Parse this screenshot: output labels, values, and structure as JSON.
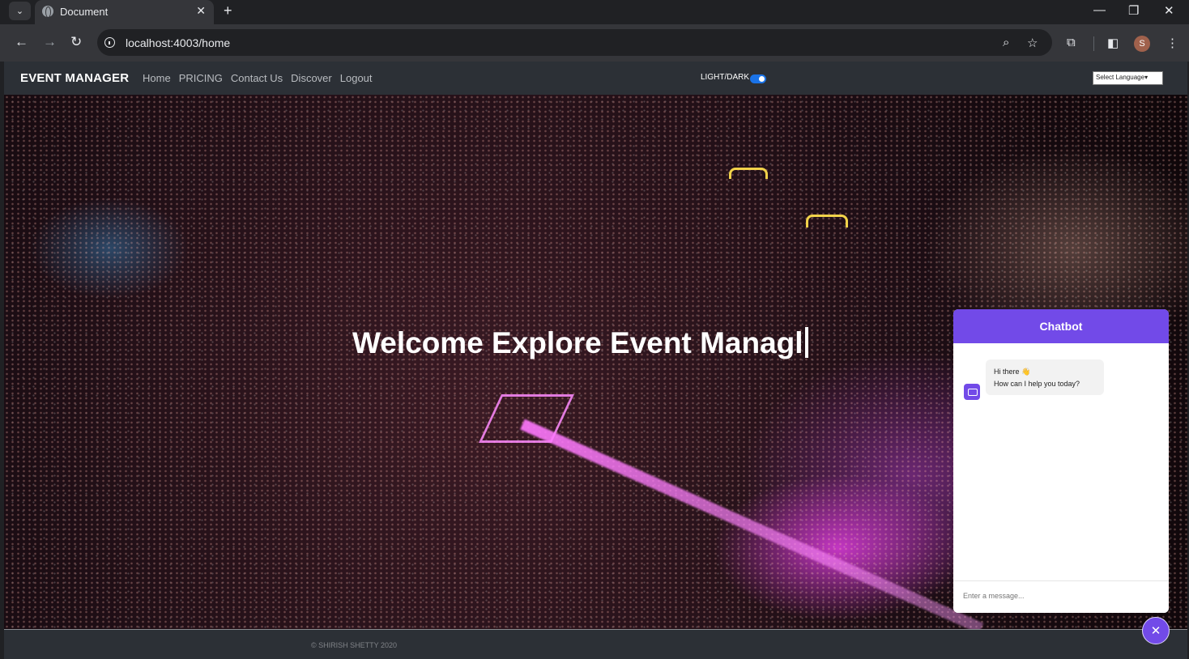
{
  "browser": {
    "tab_title": "Document",
    "url": "localhost:4003/home",
    "profile_initial": "S",
    "icons": {
      "tab_menu": "chevron-down-icon",
      "tab_favicon": "globe-icon",
      "tab_close": "close-icon",
      "new_tab": "plus-icon",
      "back": "arrow-left-icon",
      "forward": "arrow-right-icon",
      "reload": "reload-icon",
      "site_info": "info-icon",
      "zoom": "zoom-icon",
      "bookmark": "star-icon",
      "extensions": "puzzle-icon",
      "side_panel": "side-panel-icon",
      "menu": "kebab-menu-icon"
    }
  },
  "navbar": {
    "brand": "EVENT MANAGER",
    "links": [
      "Home",
      "PRICING",
      "Contact Us",
      "Discover",
      "Logout"
    ],
    "theme_toggle_label": "LIGHT/DARK",
    "theme_toggle_on": true,
    "language_select": "Select Language"
  },
  "hero": {
    "title": "Welcome Explore Event Managl"
  },
  "chatbot": {
    "title": "Chatbot",
    "message_line1": "Hi there 👋",
    "message_line2": "How can I help you today?",
    "input_placeholder": "Enter a message...",
    "toggle_icon": "close-icon"
  },
  "footer": {
    "copyright": "© SHIRISH SHETTY 2020"
  },
  "colors": {
    "accent": "#724ae8",
    "navbar_bg": "#2c3036",
    "toggle_blue": "#1a73e8"
  }
}
